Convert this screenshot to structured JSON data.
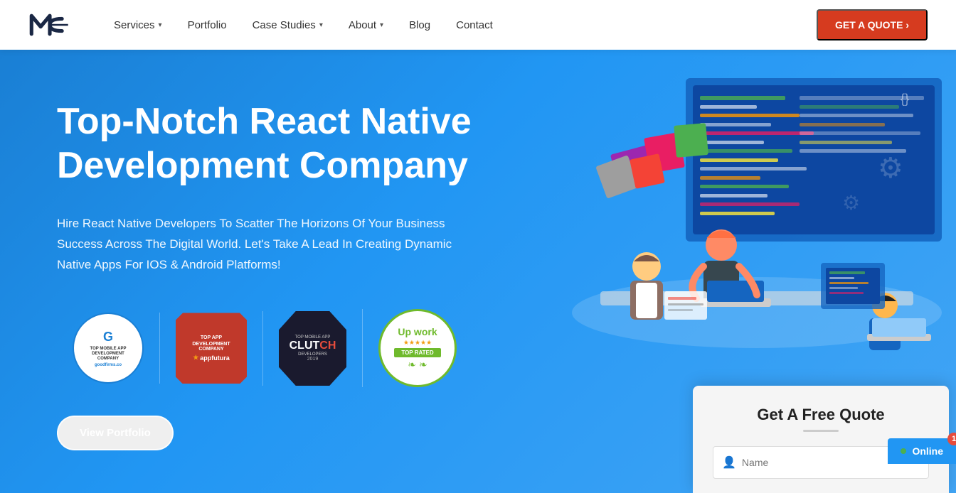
{
  "navbar": {
    "logo_text": "MC",
    "nav_items": [
      {
        "label": "Services",
        "has_dropdown": true
      },
      {
        "label": "Portfolio",
        "has_dropdown": false
      },
      {
        "label": "Case Studies",
        "has_dropdown": true
      },
      {
        "label": "About",
        "has_dropdown": true
      },
      {
        "label": "Blog",
        "has_dropdown": false
      },
      {
        "label": "Contact",
        "has_dropdown": false
      }
    ],
    "cta_label": "GET A QUOTE  ›"
  },
  "hero": {
    "title": "Top-Notch React Native Development Company",
    "description": "Hire React Native Developers To Scatter The Horizons Of Your Business Success Across The Digital World. Let's Take A Lead In Creating Dynamic Native Apps For IOS & Android Platforms!",
    "badges": [
      {
        "name": "GoodFirms",
        "subtitle": "TOP MOBILE APP DEVELOPMENT COMPANY",
        "site": "goodfirms.co"
      },
      {
        "name": "AppFutura",
        "subtitle": "TOP APP DEVELOPMENT COMPANY"
      },
      {
        "name": "Clutch",
        "subtitle": "TOP MOBILE APP DEVELOPERS 2019"
      },
      {
        "name": "Upwork",
        "subtitle": "TOP RATED"
      }
    ],
    "view_portfolio_label": "View Portfolio"
  },
  "quote_card": {
    "title": "Get A Free Quote",
    "name_placeholder": "Name"
  },
  "online_badge": {
    "label": "Online",
    "count": "1"
  }
}
